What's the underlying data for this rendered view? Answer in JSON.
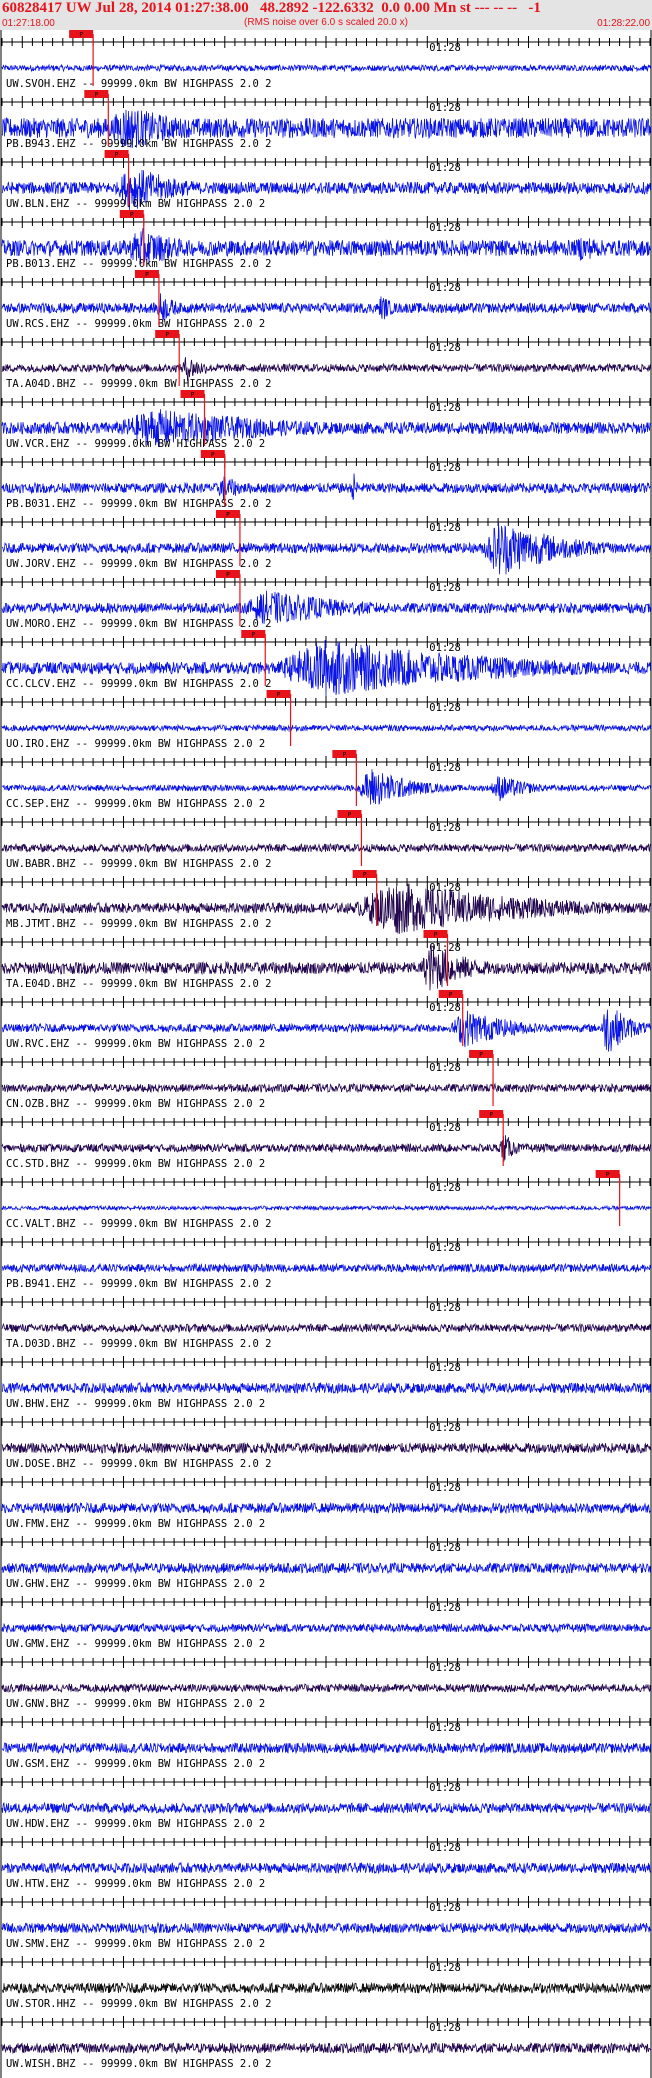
{
  "header": {
    "title": "60828417 UW Jul 28, 2014 01:27:38.00   48.2892 -122.6332  0.0 0.00 Mn st --- -- --   -1",
    "subtitle": "(RMS noise over 6.0 s scaled 20.0 x)",
    "start_time": "01:27:18.00",
    "end_time": "01:28:22.00"
  },
  "colors": {
    "trace_blue": "#0a14e6",
    "trace_dark": "#240850",
    "trace_black": "#111111",
    "pick_red": "#e8121a",
    "header_bg": "#e4e4e4"
  },
  "chart_data": {
    "type": "line",
    "x_range_seconds": [
      0,
      64
    ],
    "minute_mark_label": "01:28",
    "minute_mark_second": 42,
    "pick_label": "P",
    "traces": [
      {
        "label": "UW.SVOH.EHZ -- 99999.0km BW  HIGHPASS  2.0  2",
        "color": "trace_blue",
        "amplitude": 3,
        "pick_s": 9.0,
        "events": []
      },
      {
        "label": "PB.B943.EHZ -- 99999.0km BW  HIGHPASS  2.0  2",
        "color": "trace_blue",
        "amplitude": 10,
        "pick_s": 10.5,
        "events": [
          {
            "start": 10.0,
            "end": 24.0,
            "amp": 24
          }
        ]
      },
      {
        "label": "UW.BLN.EHZ -- 99999.0km BW  HIGHPASS  2.0  2",
        "color": "trace_blue",
        "amplitude": 6,
        "pick_s": 12.5,
        "events": [
          {
            "start": 11.0,
            "end": 22.0,
            "amp": 24
          }
        ]
      },
      {
        "label": "PB.B013.EHZ -- 99999.0km BW  HIGHPASS  2.0  2",
        "color": "trace_blue",
        "amplitude": 8,
        "pick_s": 14.0,
        "events": [
          {
            "start": 12.0,
            "end": 22.0,
            "amp": 22
          },
          {
            "start": 56.0,
            "end": 64.0,
            "amp": 14
          }
        ]
      },
      {
        "label": "UW.RCS.EHZ -- 99999.0km BW  HIGHPASS  2.0  2",
        "color": "trace_blue",
        "amplitude": 5,
        "pick_s": 15.5,
        "events": [
          {
            "start": 15.0,
            "end": 19.0,
            "amp": 16
          },
          {
            "start": 37.0,
            "end": 40.0,
            "amp": 14
          }
        ]
      },
      {
        "label": "TA.A04D.BHZ -- 99999.0km BW  HIGHPASS  2.0  2",
        "color": "trace_dark",
        "amplitude": 4,
        "pick_s": 17.5,
        "events": [
          {
            "start": 17.5,
            "end": 22.0,
            "amp": 14
          }
        ]
      },
      {
        "label": "UW.VCR.EHZ -- 99999.0km BW  HIGHPASS  2.0  2",
        "color": "trace_blue",
        "amplitude": 6,
        "pick_s": 20.0,
        "events": [
          {
            "start": 10.0,
            "end": 42.0,
            "amp": 20
          }
        ]
      },
      {
        "label": "PB.B031.EHZ -- 99999.0km BW  HIGHPASS  2.0  2",
        "color": "trace_blue",
        "amplitude": 5,
        "pick_s": 22.0,
        "events": [
          {
            "start": 21.0,
            "end": 26.0,
            "amp": 14
          },
          {
            "start": 34.5,
            "end": 35.5,
            "amp": 20
          }
        ]
      },
      {
        "label": "UW.JORV.EHZ -- 99999.0km BW  HIGHPASS  2.0  2",
        "color": "trace_blue",
        "amplitude": 5,
        "pick_s": 23.5,
        "events": [
          {
            "start": 47.0,
            "end": 61.0,
            "amp": 30
          }
        ]
      },
      {
        "label": "UW.MORO.EHZ -- 99999.0km BW  HIGHPASS  2.0  2",
        "color": "trace_blue",
        "amplitude": 5,
        "pick_s": 23.5,
        "events": [
          {
            "start": 23.0,
            "end": 44.0,
            "amp": 18
          }
        ]
      },
      {
        "label": "CC.CLCV.EHZ -- 99999.0km BW  HIGHPASS  2.0  2",
        "color": "trace_blue",
        "amplitude": 6,
        "pick_s": 26.0,
        "events": [
          {
            "start": 26.0,
            "end": 64.0,
            "amp": 30
          }
        ]
      },
      {
        "label": "UO.IRO.EHZ -- 99999.0km BW  HIGHPASS  2.0  2",
        "color": "trace_blue",
        "amplitude": 3,
        "pick_s": 28.5,
        "events": []
      },
      {
        "label": "CC.SEP.EHZ -- 99999.0km BW  HIGHPASS  2.0  2",
        "color": "trace_blue",
        "amplitude": 3,
        "pick_s": 35.0,
        "events": [
          {
            "start": 35.0,
            "end": 44.0,
            "amp": 22
          },
          {
            "start": 48.0,
            "end": 55.0,
            "amp": 14
          }
        ]
      },
      {
        "label": "UW.BABR.BHZ -- 99999.0km BW  HIGHPASS  2.0  2",
        "color": "trace_dark",
        "amplitude": 4,
        "pick_s": 35.5,
        "events": []
      },
      {
        "label": "MB.JTMT.BHZ -- 99999.0km BW  HIGHPASS  2.0  2",
        "color": "trace_dark",
        "amplitude": 5,
        "pick_s": 37.0,
        "events": [
          {
            "start": 34.0,
            "end": 64.0,
            "amp": 28
          }
        ]
      },
      {
        "label": "TA.E04D.BHZ -- 99999.0km BW  HIGHPASS  2.0  2",
        "color": "trace_dark",
        "amplitude": 6,
        "pick_s": 44.0,
        "events": [
          {
            "start": 41.0,
            "end": 50.0,
            "amp": 26
          }
        ]
      },
      {
        "label": "UW.RVC.EHZ -- 99999.0km BW  HIGHPASS  2.0  2",
        "color": "trace_blue",
        "amplitude": 4,
        "pick_s": 45.5,
        "events": [
          {
            "start": 44.0,
            "end": 55.0,
            "amp": 20
          },
          {
            "start": 59.0,
            "end": 64.0,
            "amp": 28
          }
        ]
      },
      {
        "label": "CN.OZB.BHZ -- 99999.0km BW  HIGHPASS  2.0  2",
        "color": "trace_dark",
        "amplitude": 4,
        "pick_s": 48.5,
        "events": []
      },
      {
        "label": "CC.STD.BHZ -- 99999.0km BW  HIGHPASS  2.0  2",
        "color": "trace_dark",
        "amplitude": 4,
        "pick_s": 49.5,
        "events": [
          {
            "start": 49.0,
            "end": 52.0,
            "amp": 16
          }
        ]
      },
      {
        "label": "CC.VALT.BHZ -- 99999.0km BW  HIGHPASS  2.0  2",
        "color": "trace_blue",
        "amplitude": 2,
        "pick_s": 61.0,
        "events": []
      },
      {
        "label": "PB.B941.EHZ -- 99999.0km BW  HIGHPASS  2.0  2",
        "color": "trace_blue",
        "amplitude": 4,
        "pick_s": null,
        "events": []
      },
      {
        "label": "TA.D03D.BHZ -- 99999.0km BW  HIGHPASS  2.0  2",
        "color": "trace_dark",
        "amplitude": 4,
        "pick_s": null,
        "events": []
      },
      {
        "label": "UW.BHW.EHZ -- 99999.0km BW  HIGHPASS  2.0  2",
        "color": "trace_blue",
        "amplitude": 5,
        "pick_s": null,
        "events": []
      },
      {
        "label": "UW.DOSE.BHZ -- 99999.0km BW  HIGHPASS  2.0  2",
        "color": "trace_dark",
        "amplitude": 5,
        "pick_s": null,
        "events": []
      },
      {
        "label": "UW.FMW.EHZ -- 99999.0km BW  HIGHPASS  2.0  2",
        "color": "trace_blue",
        "amplitude": 5,
        "pick_s": null,
        "events": []
      },
      {
        "label": "UW.GHW.EHZ -- 99999.0km BW  HIGHPASS  2.0  2",
        "color": "trace_blue",
        "amplitude": 5,
        "pick_s": null,
        "events": []
      },
      {
        "label": "UW.GMW.EHZ -- 99999.0km BW  HIGHPASS  2.0  2",
        "color": "trace_blue",
        "amplitude": 4,
        "pick_s": null,
        "events": []
      },
      {
        "label": "UW.GNW.BHZ -- 99999.0km BW  HIGHPASS  2.0  2",
        "color": "trace_dark",
        "amplitude": 4,
        "pick_s": null,
        "events": []
      },
      {
        "label": "UW.GSM.EHZ -- 99999.0km BW  HIGHPASS  2.0  2",
        "color": "trace_blue",
        "amplitude": 5,
        "pick_s": null,
        "events": []
      },
      {
        "label": "UW.HDW.EHZ -- 99999.0km BW  HIGHPASS  2.0  2",
        "color": "trace_blue",
        "amplitude": 5,
        "pick_s": null,
        "events": []
      },
      {
        "label": "UW.HTW.EHZ -- 99999.0km BW  HIGHPASS  2.0  2",
        "color": "trace_blue",
        "amplitude": 5,
        "pick_s": null,
        "events": []
      },
      {
        "label": "UW.SMW.EHZ -- 99999.0km BW  HIGHPASS  2.0  2",
        "color": "trace_blue",
        "amplitude": 5,
        "pick_s": null,
        "events": []
      },
      {
        "label": "UW.STOR.HHZ -- 99999.0km BW  HIGHPASS  2.0  2",
        "color": "trace_black",
        "amplitude": 5,
        "pick_s": null,
        "events": []
      },
      {
        "label": "UW.WISH.BHZ -- 99999.0km BW  HIGHPASS  2.0  2",
        "color": "trace_dark",
        "amplitude": 5,
        "pick_s": null,
        "events": []
      }
    ]
  }
}
